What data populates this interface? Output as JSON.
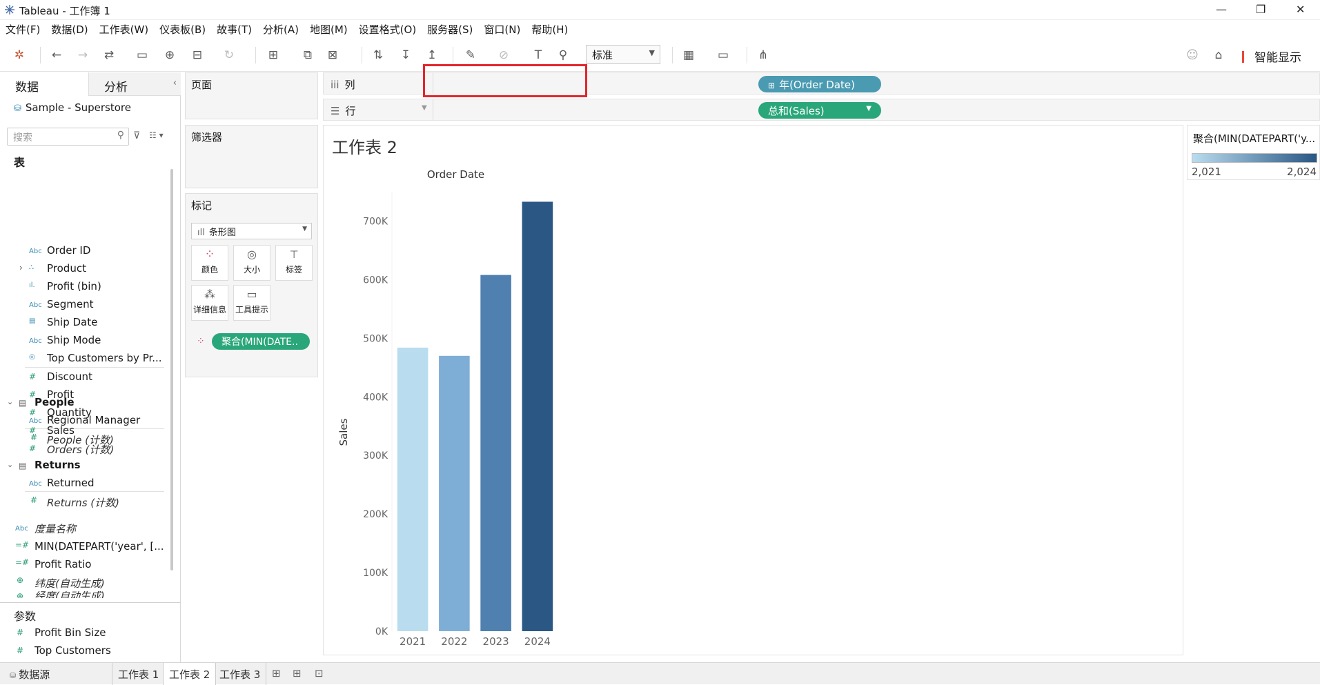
{
  "window": {
    "title": "Tableau - 工作簿 1"
  },
  "menu": [
    "文件(F)",
    "数据(D)",
    "工作表(W)",
    "仪表板(B)",
    "故事(T)",
    "分析(A)",
    "地图(M)",
    "设置格式(O)",
    "服务器(S)",
    "窗口(N)",
    "帮助(H)"
  ],
  "toolbar": {
    "fit_select": "标准",
    "smart_show": "智能显示"
  },
  "left": {
    "tab_data": "数据",
    "tab_analysis": "分析",
    "datasource": "Sample - Superstore",
    "search_placeholder": "搜索",
    "tables_header": "表",
    "orders_fields": [
      {
        "label": "Order ID",
        "icon": "Abc"
      },
      {
        "label": "Product",
        "icon": "hier"
      },
      {
        "label": "Profit (bin)",
        "icon": "bin"
      },
      {
        "label": "Segment",
        "icon": "Abc"
      },
      {
        "label": "Ship Date",
        "icon": "date"
      },
      {
        "label": "Ship Mode",
        "icon": "Abc"
      },
      {
        "label": "Top Customers by Pr...",
        "icon": "set"
      },
      {
        "label": "Discount",
        "icon": "#"
      },
      {
        "label": "Profit",
        "icon": "#"
      },
      {
        "label": "Quantity",
        "icon": "#"
      },
      {
        "label": "Sales",
        "icon": "#"
      },
      {
        "label": "Orders (计数)",
        "icon": "#"
      }
    ],
    "people": {
      "label": "People",
      "fields": [
        "Regional Manager",
        "People (计数)"
      ]
    },
    "returns": {
      "label": "Returns",
      "fields": [
        "Returned",
        "Returns (计数)"
      ]
    },
    "extra_fields": [
      "度量名称",
      "MIN(DATEPART('year', [...",
      "Profit Ratio",
      "纬度(自动生成)",
      "经度(自动生成)"
    ],
    "params_header": "参数",
    "params": [
      "Profit Bin Size",
      "Top Customers"
    ]
  },
  "cards": {
    "pages": "页面",
    "filters": "筛选器",
    "marks": "标记",
    "mark_type": "条形图",
    "mark_buttons": [
      "颜色",
      "大小",
      "标签",
      "详细信息",
      "工具提示"
    ],
    "mark_pill": "聚合(MIN(DATE.."
  },
  "shelves": {
    "columns_label": "列",
    "rows_label": "行",
    "columns_pill": "年(Order Date)",
    "rows_pill": "总和(Sales)"
  },
  "sheet": {
    "title": "工作表 2"
  },
  "legend": {
    "title": "聚合(MIN(DATEPART('y...",
    "min_label": "2,021",
    "max_label": "2,024",
    "color_from": "#b9dcef",
    "color_to": "#2a5783"
  },
  "chart_data": {
    "type": "bar",
    "title": "Order Date",
    "xlabel": "",
    "ylabel": "Sales",
    "categories": [
      "2021",
      "2022",
      "2023",
      "2024"
    ],
    "values": [
      484000,
      470000,
      608000,
      733000
    ],
    "colors": [
      "#b9dcef",
      "#7eaed6",
      "#4f80b0",
      "#2a5783"
    ],
    "ylim": [
      0,
      750000
    ],
    "yticks": [
      "0K",
      "100K",
      "200K",
      "300K",
      "400K",
      "500K",
      "600K",
      "700K"
    ],
    "ytick_values": [
      0,
      100000,
      200000,
      300000,
      400000,
      500000,
      600000,
      700000
    ]
  },
  "bottom": {
    "datasource_tab": "数据源",
    "sheets": [
      "工作表 1",
      "工作表 2",
      "工作表 3"
    ]
  }
}
